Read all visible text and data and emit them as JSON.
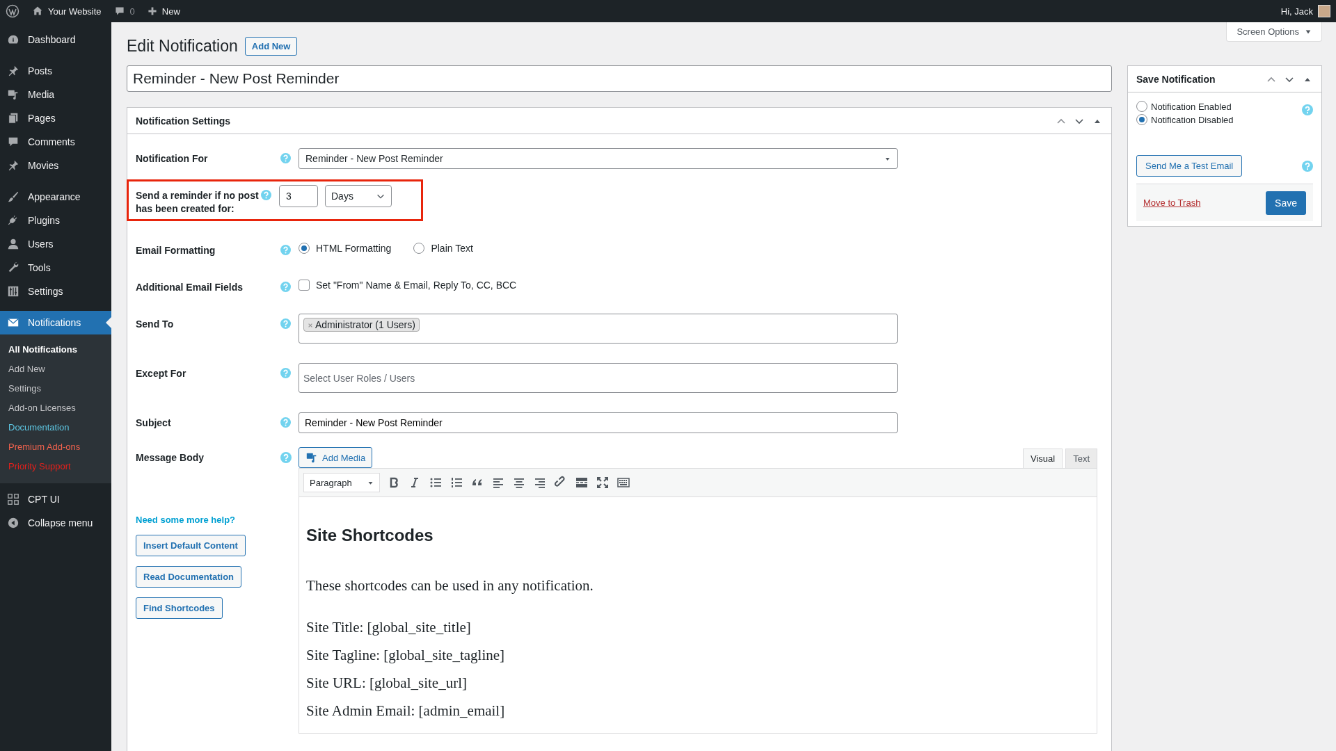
{
  "admin_bar": {
    "site": "Your Website",
    "comments": "0",
    "new": "New",
    "greeting": "Hi, Jack"
  },
  "menu": [
    {
      "items": [
        {
          "label": "Dashboard",
          "selected": false
        }
      ]
    },
    {
      "items": [
        {
          "label": "Posts",
          "selected": false
        },
        {
          "label": "Media",
          "selected": false
        },
        {
          "label": "Pages",
          "selected": false
        },
        {
          "label": "Comments",
          "selected": false
        },
        {
          "label": "Movies",
          "selected": false
        }
      ]
    },
    {
      "items": [
        {
          "label": "Appearance",
          "selected": false
        },
        {
          "label": "Plugins",
          "selected": false
        },
        {
          "label": "Users",
          "selected": false
        },
        {
          "label": "Tools",
          "selected": false
        },
        {
          "label": "Settings",
          "selected": false
        }
      ]
    },
    {
      "items": [
        {
          "label": "Notifications",
          "selected": true,
          "submenu": [
            {
              "label": "All Notifications",
              "selected": true,
              "color": "#ffffff"
            },
            {
              "label": "Add New",
              "selected": false,
              "color": "#c3c4c7"
            },
            {
              "label": "Settings",
              "selected": false,
              "color": "#c3c4c7"
            },
            {
              "label": "Add-on Licenses",
              "selected": false,
              "color": "#c3c4c7"
            },
            {
              "label": "Documentation",
              "selected": false,
              "color": "#5ec8e4"
            },
            {
              "label": "Premium Add-ons",
              "selected": false,
              "color": "#f0624d"
            },
            {
              "label": "Priority Support",
              "selected": false,
              "color": "#e3201b"
            }
          ]
        },
        {
          "label": "CPT UI",
          "selected": false
        },
        {
          "label": "Collapse menu",
          "selected": false
        }
      ]
    }
  ],
  "screen_options": "Screen Options",
  "page": {
    "heading": "Edit Notification",
    "add_new": "Add New",
    "title": "Reminder - New Post Reminder"
  },
  "settings_box": {
    "title": "Notification Settings",
    "rows": [
      {
        "kind": "select",
        "label": "Notification For",
        "value": "Reminder - New Post Reminder",
        "highlighted": false
      },
      {
        "kind": "reminder",
        "label": "Send a reminder if no post has been created for:",
        "value": "3",
        "unit": "Days",
        "highlighted": true
      },
      {
        "kind": "radio",
        "label": "Email Formatting",
        "highlighted": false,
        "options": [
          {
            "label": "HTML Formatting",
            "selected": true
          },
          {
            "label": "Plain Text",
            "selected": false
          }
        ]
      },
      {
        "kind": "checkbox",
        "label": "Additional Email Fields",
        "highlighted": false,
        "option": "Set \"From\" Name & Email, Reply To, CC, BCC",
        "checked": false
      },
      {
        "kind": "tags",
        "label": "Send To",
        "highlighted": false,
        "tags": [
          "Administrator (1 Users)"
        ]
      },
      {
        "kind": "text",
        "label": "Except For",
        "highlighted": false,
        "placeholder": "Select User Roles / Users"
      },
      {
        "kind": "text",
        "label": "Subject",
        "highlighted": false,
        "value": "Reminder - New Post Reminder"
      }
    ],
    "message_body": {
      "label": "Message Body",
      "add_media": "Add Media",
      "tabs": [
        {
          "label": "Visual",
          "selected": true
        },
        {
          "label": "Text",
          "selected": false
        }
      ],
      "format": "Paragraph",
      "heading": "Site Shortcodes",
      "intro": "These shortcodes can be used in any notification.",
      "lines": [
        "Site Title: [global_site_title]",
        "Site Tagline: [global_site_tagline]",
        "Site URL: [global_site_url]",
        "Site Admin Email: [admin_email]"
      ]
    },
    "help": {
      "link": "Need some more help?",
      "buttons": [
        "Insert Default Content",
        "Read Documentation",
        "Find Shortcodes"
      ]
    }
  },
  "save_box": {
    "title": "Save Notification",
    "status": [
      {
        "label": "Notification Enabled",
        "selected": false
      },
      {
        "label": "Notification Disabled",
        "selected": true
      }
    ],
    "test_email": "Send Me a Test Email",
    "trash": "Move to Trash",
    "save": "Save"
  }
}
